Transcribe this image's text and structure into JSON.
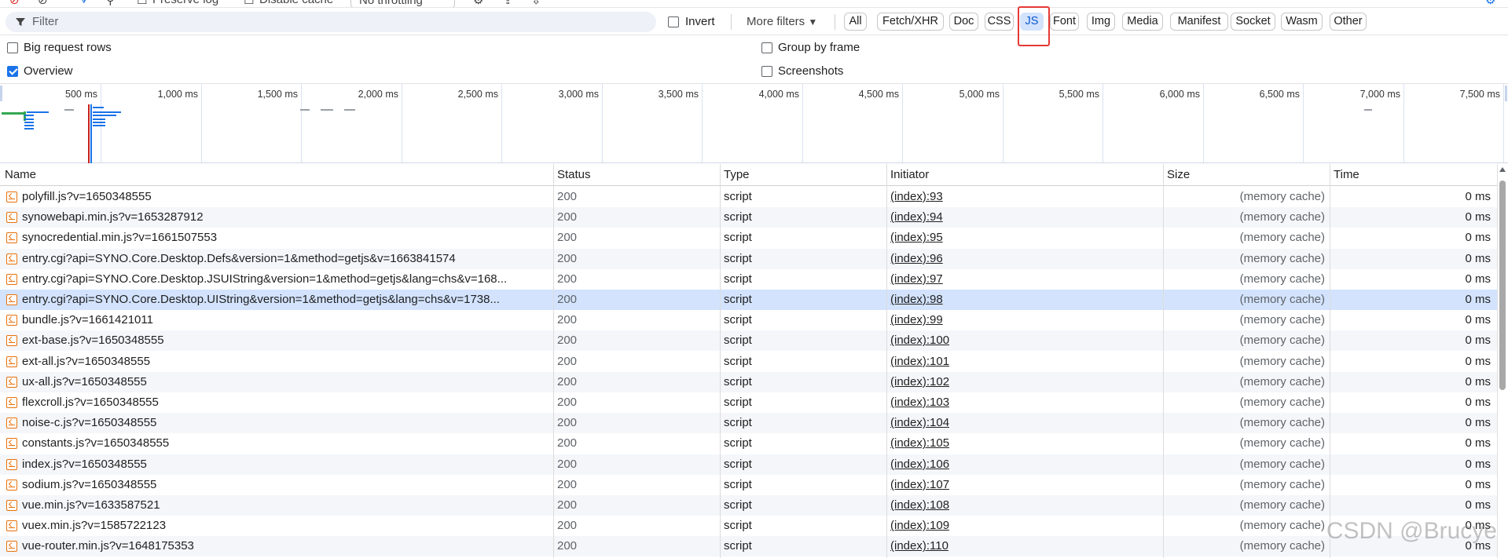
{
  "toolbar": {
    "preserve_log": "Preserve log",
    "disable_cache": "Disable cache",
    "throttling": "No throttling"
  },
  "filter": {
    "placeholder": "Filter",
    "invert": "Invert",
    "more_filters": "More filters",
    "types": [
      "All",
      "Fetch/XHR",
      "Doc",
      "CSS",
      "JS",
      "Font",
      "Img",
      "Media",
      "Manifest",
      "Socket",
      "Wasm",
      "Other"
    ],
    "selected": "JS"
  },
  "options": {
    "big_request_rows": "Big request rows",
    "group_by_frame": "Group by frame",
    "overview": "Overview",
    "screenshots": "Screenshots",
    "overview_checked": true,
    "big_request_rows_checked": false,
    "group_by_frame_checked": false,
    "screenshots_checked": false
  },
  "timeline": {
    "labels": [
      "500 ms",
      "1,000 ms",
      "1,500 ms",
      "2,000 ms",
      "2,500 ms",
      "3,000 ms",
      "3,500 ms",
      "4,000 ms",
      "4,500 ms",
      "5,000 ms",
      "5,500 ms",
      "6,000 ms",
      "6,500 ms",
      "7,000 ms",
      "7,500 ms"
    ]
  },
  "table": {
    "headers": {
      "name": "Name",
      "status": "Status",
      "type": "Type",
      "initiator": "Initiator",
      "size": "Size",
      "time": "Time"
    },
    "rows": [
      {
        "name": "polyfill.js?v=1650348555",
        "status": "200",
        "type": "script",
        "initiator": "(index):93",
        "size": "(memory cache)",
        "time": "0 ms"
      },
      {
        "name": "synowebapi.min.js?v=1653287912",
        "status": "200",
        "type": "script",
        "initiator": "(index):94",
        "size": "(memory cache)",
        "time": "0 ms"
      },
      {
        "name": "synocredential.min.js?v=1661507553",
        "status": "200",
        "type": "script",
        "initiator": "(index):95",
        "size": "(memory cache)",
        "time": "0 ms"
      },
      {
        "name": "entry.cgi?api=SYNO.Core.Desktop.Defs&version=1&method=getjs&v=1663841574",
        "status": "200",
        "type": "script",
        "initiator": "(index):96",
        "size": "(memory cache)",
        "time": "0 ms"
      },
      {
        "name": "entry.cgi?api=SYNO.Core.Desktop.JSUIString&version=1&method=getjs&lang=chs&v=168...",
        "status": "200",
        "type": "script",
        "initiator": "(index):97",
        "size": "(memory cache)",
        "time": "0 ms"
      },
      {
        "name": "entry.cgi?api=SYNO.Core.Desktop.UIString&version=1&method=getjs&lang=chs&v=1738...",
        "status": "200",
        "type": "script",
        "initiator": "(index):98",
        "size": "(memory cache)",
        "time": "0 ms",
        "selected": true
      },
      {
        "name": "bundle.js?v=1661421011",
        "status": "200",
        "type": "script",
        "initiator": "(index):99",
        "size": "(memory cache)",
        "time": "0 ms"
      },
      {
        "name": "ext-base.js?v=1650348555",
        "status": "200",
        "type": "script",
        "initiator": "(index):100",
        "size": "(memory cache)",
        "time": "0 ms"
      },
      {
        "name": "ext-all.js?v=1650348555",
        "status": "200",
        "type": "script",
        "initiator": "(index):101",
        "size": "(memory cache)",
        "time": "0 ms"
      },
      {
        "name": "ux-all.js?v=1650348555",
        "status": "200",
        "type": "script",
        "initiator": "(index):102",
        "size": "(memory cache)",
        "time": "0 ms"
      },
      {
        "name": "flexcroll.js?v=1650348555",
        "status": "200",
        "type": "script",
        "initiator": "(index):103",
        "size": "(memory cache)",
        "time": "0 ms"
      },
      {
        "name": "noise-c.js?v=1650348555",
        "status": "200",
        "type": "script",
        "initiator": "(index):104",
        "size": "(memory cache)",
        "time": "0 ms"
      },
      {
        "name": "constants.js?v=1650348555",
        "status": "200",
        "type": "script",
        "initiator": "(index):105",
        "size": "(memory cache)",
        "time": "0 ms"
      },
      {
        "name": "index.js?v=1650348555",
        "status": "200",
        "type": "script",
        "initiator": "(index):106",
        "size": "(memory cache)",
        "time": "0 ms"
      },
      {
        "name": "sodium.js?v=1650348555",
        "status": "200",
        "type": "script",
        "initiator": "(index):107",
        "size": "(memory cache)",
        "time": "0 ms"
      },
      {
        "name": "vue.min.js?v=1633587521",
        "status": "200",
        "type": "script",
        "initiator": "(index):108",
        "size": "(memory cache)",
        "time": "0 ms"
      },
      {
        "name": "vuex.min.js?v=1585722123",
        "status": "200",
        "type": "script",
        "initiator": "(index):109",
        "size": "(memory cache)",
        "time": "0 ms"
      },
      {
        "name": "vue-router.min.js?v=1648175353",
        "status": "200",
        "type": "script",
        "initiator": "(index):110",
        "size": "(memory cache)",
        "time": "0 ms"
      }
    ]
  },
  "watermark": "CSDN @Brucye",
  "colors": {
    "accent": "#1a73e8",
    "selected_row": "#d3e3fd",
    "highlight_box": "#e53935",
    "js_icon": "#e8710a"
  }
}
